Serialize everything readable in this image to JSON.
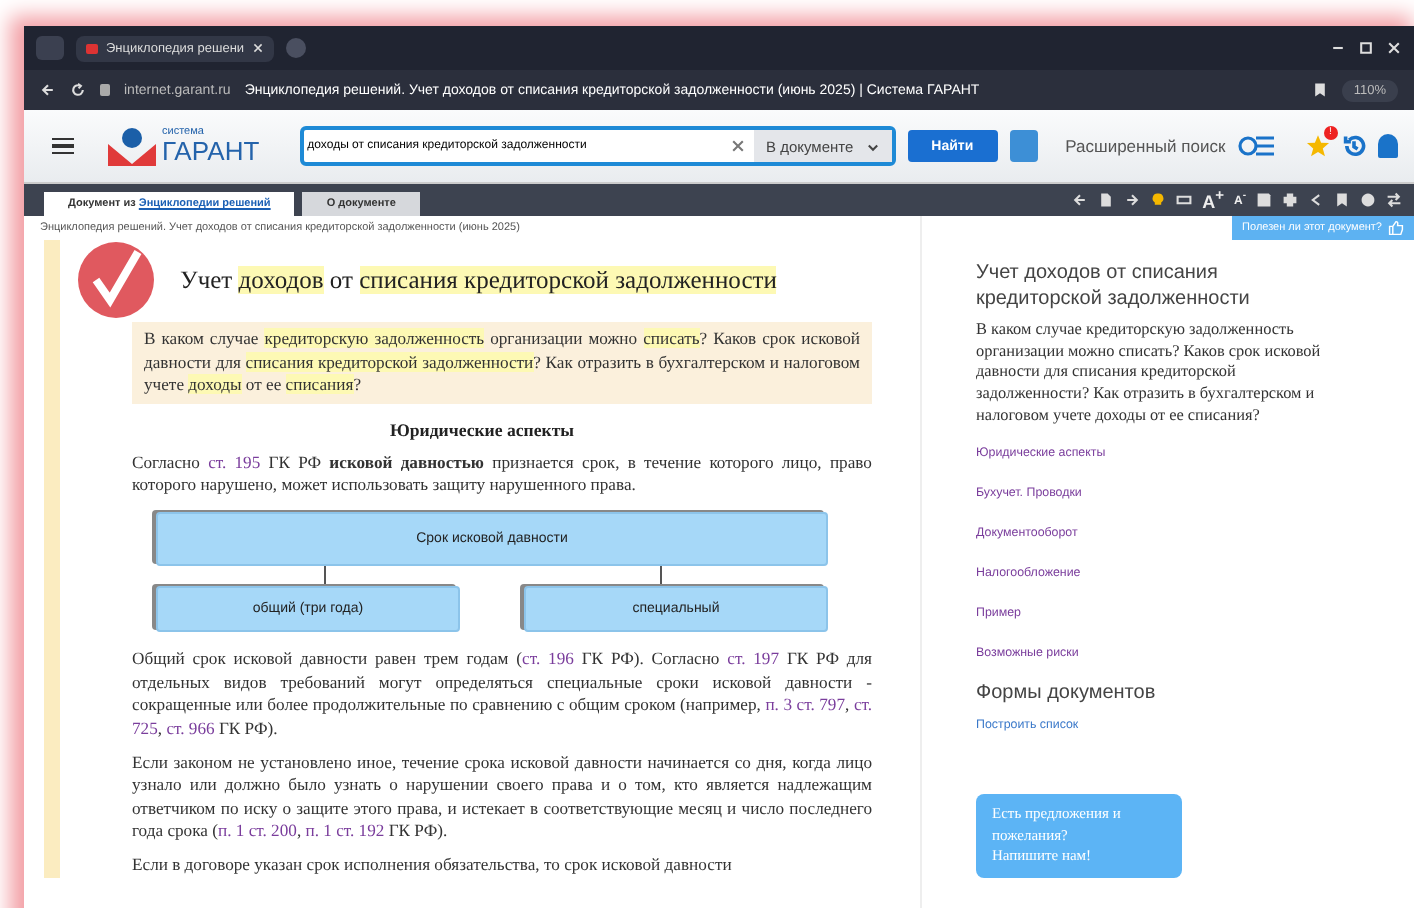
{
  "browser": {
    "tab_title": "Энциклопедия решени",
    "url": "internet.garant.ru",
    "page_title": "Энциклопедия решений. Учет доходов от списания кредиторской задолженности (июнь 2025) | Система ГАРАНТ",
    "zoom": "110%"
  },
  "header": {
    "logo_small": "система",
    "logo_big": "ГАРАНТ",
    "search_value": "доходы от списания кредиторской задолженности",
    "scope": "В документе",
    "find_button": "Найти",
    "advanced_search": "Расширенный поиск",
    "badge": "!"
  },
  "doc_tabs": [
    {
      "parts": [
        {
          "t": "Документ из ",
          "kind": "text"
        },
        {
          "t": "Энциклопедии решений",
          "kind": "link"
        }
      ],
      "selected": true
    },
    {
      "parts": [
        {
          "t": "О документе",
          "kind": "text"
        }
      ],
      "selected": false
    }
  ],
  "toolbar": {
    "font_larger": "A$^{+}$",
    "font_smaller": "A$^{-}$"
  },
  "breadcrumb": "Энциклопедия решений. Учет доходов от списания кредиторской задолженности (июнь 2025)",
  "feedback": "Полезен ли этот документ?",
  "title": [
    {
      "t": "Учет ",
      "hl": false
    },
    {
      "t": "доходов",
      "hl": true
    },
    {
      "t": " от ",
      "hl": false
    },
    {
      "t": "списания кредиторской задолженности",
      "hl": true
    }
  ],
  "question": [
    {
      "t": "В каком случае ",
      "hl": false
    },
    {
      "t": "кредиторскую задолженность",
      "hl": true
    },
    {
      "t": " организации можно ",
      "hl": false
    },
    {
      "t": "списать",
      "hl": true
    },
    {
      "t": "? Каков срок исковой давности для ",
      "hl": false
    },
    {
      "t": "списания кредиторской задолженности",
      "hl": true
    },
    {
      "t": "? Как отразить в бухгалтерском и налоговом учете ",
      "hl": false
    },
    {
      "t": "доходы",
      "hl": true
    },
    {
      "t": " от ее ",
      "hl": false
    },
    {
      "t": "списания",
      "hl": true
    },
    {
      "t": "?",
      "hl": false
    }
  ],
  "section_heading": "Юридические аспекты",
  "paragraph_1": [
    {
      "t": "Согласно ",
      "kind": "text"
    },
    {
      "t": "ст. 195",
      "kind": "link"
    },
    {
      "t": " ГК РФ ",
      "kind": "text"
    },
    {
      "t": "исковой давностью",
      "kind": "bold"
    },
    {
      "t": " признается срок, в течение которого лицо, право которого нарушено, может использовать защиту нарушенного права.",
      "kind": "text"
    }
  ],
  "diagram": {
    "root": "Срок исковой давности",
    "branches": [
      "общий (три года)",
      "специальный"
    ]
  },
  "paragraphs": [
    [
      {
        "t": "Общий срок исковой давности равен трем годам (",
        "kind": "text"
      },
      {
        "t": "ст. 196",
        "kind": "link"
      },
      {
        "t": " ГК РФ). Согласно ",
        "kind": "text"
      },
      {
        "t": "ст. 197",
        "kind": "link"
      },
      {
        "t": " ГК РФ для отдельных видов требований могут определяться специальные сроки исковой давности - сокращенные или более продолжительные по сравнению с общим сроком (например, ",
        "kind": "text"
      },
      {
        "t": "п. 3 ст. 797",
        "kind": "link"
      },
      {
        "t": ", ",
        "kind": "text"
      },
      {
        "t": "ст. 725",
        "kind": "link"
      },
      {
        "t": ", ",
        "kind": "text"
      },
      {
        "t": "ст. 966",
        "kind": "link"
      },
      {
        "t": " ГК РФ).",
        "kind": "text"
      }
    ],
    [
      {
        "t": "Если законом не установлено иное, течение срока исковой давности начинается со дня, когда лицо узнало или должно было узнать о нарушении своего права и о том, кто является надлежащим ответчиком по иску о защите этого права, и истекает в соответствующие месяц и число последнего года срока (",
        "kind": "text"
      },
      {
        "t": "п. 1 ст. 200",
        "kind": "link"
      },
      {
        "t": ", ",
        "kind": "text"
      },
      {
        "t": "п. 1 ст. 192",
        "kind": "link"
      },
      {
        "t": " ГК РФ).",
        "kind": "text"
      }
    ],
    [
      {
        "t": "Если в договоре указан срок исполнения обязательства, то срок исковой давности",
        "kind": "text"
      }
    ]
  ],
  "sidebar": {
    "title": "Учет доходов от списания кредиторской задолженности",
    "question": "В каком случае кредиторскую задолженность организации можно списать? Каков срок исковой давности для списания кредиторской задолженности? Как отразить в бухгалтерском и налоговом учете доходы от ее списания?",
    "links": [
      "Юридические аспекты",
      "Бухучет. Проводки",
      "Документооборот",
      "Налогообложение",
      "Пример",
      "Возможные риски"
    ],
    "forms_heading": "Формы документов",
    "forms_link": "Построить список",
    "suggest": [
      "Есть предложения и пожелания?",
      "Напишите нам!"
    ]
  }
}
